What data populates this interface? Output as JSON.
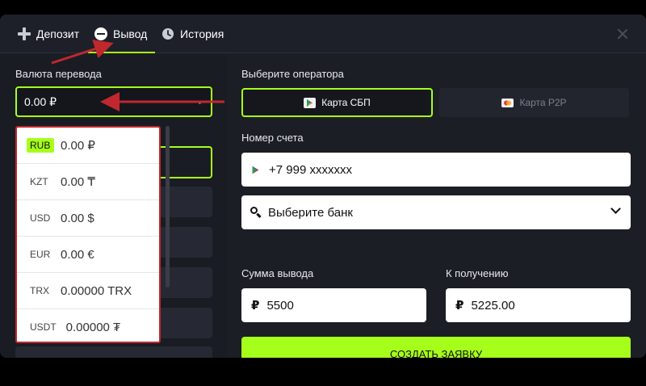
{
  "header": {
    "tabs": [
      {
        "label": "Депозит",
        "icon": "plus-icon"
      },
      {
        "label": "Вывод",
        "icon": "minus-circle-icon",
        "active": true
      },
      {
        "label": "История",
        "icon": "clock-icon"
      }
    ]
  },
  "left": {
    "currency_label": "Валюта перевода",
    "currency_value": "0.00 ₽",
    "currencies": [
      {
        "code": "RUB",
        "value": "0.00 ₽",
        "active": true
      },
      {
        "code": "KZT",
        "value": "0.00 ₸"
      },
      {
        "code": "USD",
        "value": "0.00 $"
      },
      {
        "code": "EUR",
        "value": "0.00 €"
      },
      {
        "code": "TRX",
        "value": "0.00000 TRX"
      },
      {
        "code": "USDT",
        "value": "0.00000 ₮"
      }
    ]
  },
  "right": {
    "operator_label": "Выберите оператора",
    "operators": [
      {
        "label": "Карта СБП",
        "active": true
      },
      {
        "label": "Карта P2P"
      }
    ],
    "account_label": "Номер счета",
    "account_value": "+7 999 xxxxxxx",
    "bank_placeholder": "Выберите банк",
    "amount_label": "Сумма вывода",
    "amount_value": "5500",
    "receive_label": "К получению",
    "receive_value": "5225.00",
    "currency_symbol": "₽",
    "submit_label": "СОЗДАТЬ ЗАЯВКУ"
  },
  "colors": {
    "accent": "#a6ff1a",
    "annotation": "#c0282d",
    "panel": "#1c1e26"
  }
}
